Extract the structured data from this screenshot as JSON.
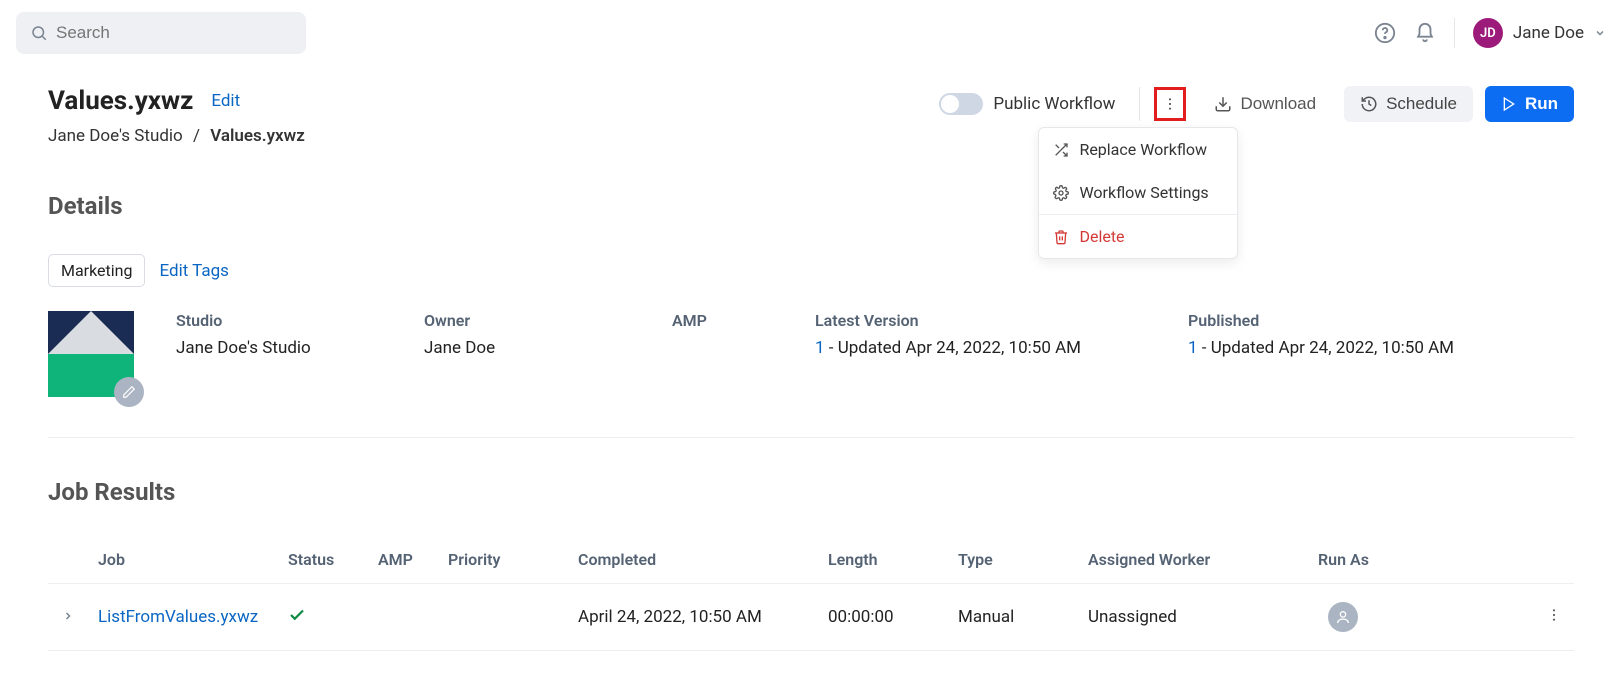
{
  "search": {
    "placeholder": "Search"
  },
  "user": {
    "initials": "JD",
    "name": "Jane Doe"
  },
  "page": {
    "title": "Values.yxwz",
    "edit_label": "Edit",
    "breadcrumb": {
      "studio": "Jane Doe's Studio",
      "current": "Values.yxwz"
    }
  },
  "actions": {
    "public_label": "Public Workflow",
    "download": "Download",
    "schedule": "Schedule",
    "run": "Run",
    "menu": {
      "replace": "Replace Workflow",
      "settings": "Workflow Settings",
      "delete": "Delete"
    }
  },
  "details": {
    "heading": "Details",
    "tag": "Marketing",
    "edit_tags": "Edit Tags",
    "labels": {
      "studio": "Studio",
      "owner": "Owner",
      "amp": "AMP",
      "latest": "Latest Version",
      "published": "Published"
    },
    "values": {
      "studio": "Jane Doe's Studio",
      "owner": "Jane Doe",
      "latest_num": "1",
      "latest_text": " - Updated Apr 24, 2022, 10:50 AM",
      "published_num": "1",
      "published_text": " - Updated Apr 24, 2022, 10:50 AM"
    }
  },
  "jobs": {
    "heading": "Job Results",
    "headers": {
      "job": "Job",
      "status": "Status",
      "amp": "AMP",
      "priority": "Priority",
      "completed": "Completed",
      "length": "Length",
      "type": "Type",
      "worker": "Assigned Worker",
      "runas": "Run As"
    },
    "rows": [
      {
        "job": "ListFromValues.yxwz",
        "completed": "April 24, 2022, 10:50 AM",
        "length": "00:00:00",
        "type": "Manual",
        "worker": "Unassigned"
      }
    ]
  }
}
